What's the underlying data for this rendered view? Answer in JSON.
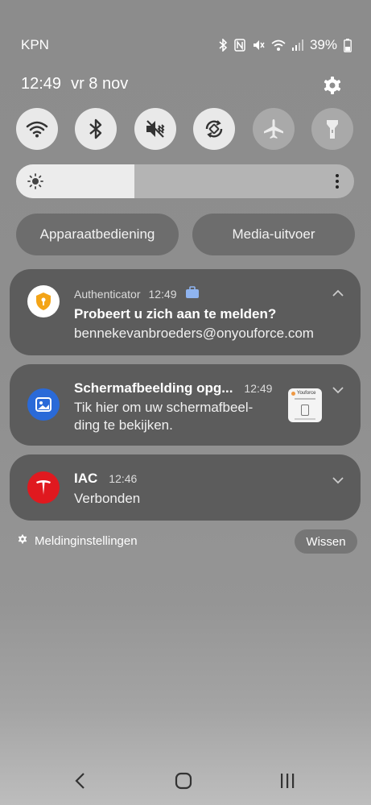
{
  "status_bar": {
    "carrier": "KPN",
    "battery": "39%",
    "icons": [
      "bluetooth-icon",
      "nfc-icon",
      "mute-icon",
      "wifi-icon",
      "signal-icon",
      "battery-icon"
    ]
  },
  "header": {
    "time": "12:49",
    "date": "vr 8 nov"
  },
  "quick_toggles": [
    {
      "name": "wifi",
      "state": "on"
    },
    {
      "name": "bluetooth",
      "state": "on"
    },
    {
      "name": "sound-mute",
      "state": "on"
    },
    {
      "name": "auto-rotate",
      "state": "on"
    },
    {
      "name": "airplane-mode",
      "state": "off"
    },
    {
      "name": "flashlight",
      "state": "off"
    }
  ],
  "brightness": {
    "level": 0.35
  },
  "controls": {
    "device_control": "Apparaatbediening",
    "media_output": "Media-uitvoer"
  },
  "notifications": [
    {
      "app": "Authenticator",
      "time": "12:49",
      "badge": "work-profile-icon",
      "title": "Probeert u zich aan te melden?",
      "body": "bennekevanbroeders@onyouforce.com",
      "icon_color": "#f3a417"
    },
    {
      "title": "Schermafbeelding opg...",
      "time": "12:49",
      "body_line1": "Tik hier om uw schermafbeel-",
      "body_line2": "ding te bekijken.",
      "icon_color": "#2a6ad8",
      "thumb_label": "Youforce"
    },
    {
      "title": "IAC",
      "time": "12:46",
      "body": "Verbonden",
      "icon_color": "#e0191f"
    }
  ],
  "footer": {
    "settings_label": "Meldinginstellingen",
    "clear_label": "Wissen"
  },
  "colors": {
    "toggle_on": "#e9e9e9",
    "toggle_off": "#a9a9a9",
    "card_bg": "#5c5c5c",
    "pill_bg": "#6d6d6d"
  }
}
